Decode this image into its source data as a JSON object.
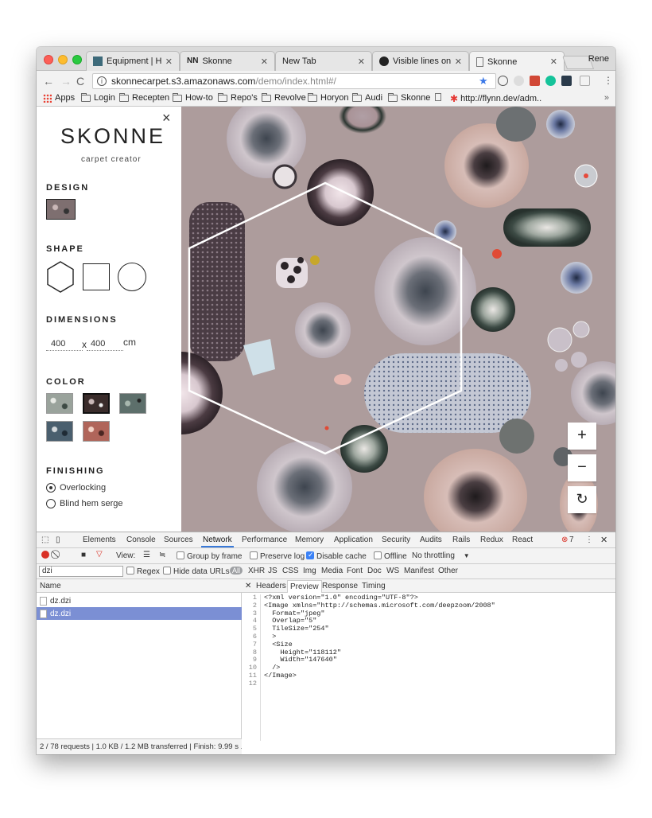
{
  "window": {
    "profile": "Rene",
    "tabs": [
      {
        "title": "Equipment | Horyo",
        "icon": "horyon-favicon"
      },
      {
        "title": "Skonne",
        "icon": "nn-favicon"
      },
      {
        "title": "New Tab",
        "icon": "blank"
      },
      {
        "title": "Visible lines on Fir",
        "icon": "github-favicon"
      },
      {
        "title": "Skonne",
        "icon": "page-icon"
      }
    ],
    "url_host": "skonnecarpet.s3.amazonaws.com",
    "url_path": "/demo/index.html#/",
    "bookmarks": [
      "Apps",
      "Login",
      "Recepten",
      "How-to",
      "Repo's",
      "Revolve",
      "Horyon",
      "Audi",
      "Skonne",
      "http://flynn.dev/adm.."
    ],
    "bookmarks_more": "»"
  },
  "sidebar": {
    "close": "×",
    "logo": "SKONNE",
    "subtitle": "carpet creator",
    "design_label": "DESIGN",
    "shape_label": "SHAPE",
    "dimensions_label": "DIMENSIONS",
    "width": "400",
    "height": "400",
    "times": "x",
    "unit": "cm",
    "color_label": "COLOR",
    "finishing_label": "FINISHING",
    "finishing_options": [
      "Overlocking",
      "Blind hem serge"
    ],
    "finishing_selected": "Overlocking",
    "color_swatches": [
      "#9aa39c",
      "#3a2c2b",
      "#5d6f6b",
      "#4a5f6e",
      "#b0655a"
    ]
  },
  "zoom": {
    "plus": "+",
    "minus": "−",
    "reset": "↻"
  },
  "devtools": {
    "tabs": [
      "Elements",
      "Console",
      "Sources",
      "Network",
      "Performance",
      "Memory",
      "Application",
      "Security",
      "Audits",
      "Rails",
      "Redux",
      "React"
    ],
    "active_tab": "Network",
    "error_count": "7",
    "toolbar": {
      "view": "View:",
      "group_by_frame": "Group by frame",
      "preserve_log": "Preserve log",
      "disable_cache": "Disable cache",
      "offline": "Offline",
      "throttling": "No throttling"
    },
    "filter_value": "dzi",
    "filter_opts": {
      "regex": "Regex",
      "hide_data_urls": "Hide data URLs",
      "all": "All"
    },
    "types": [
      "XHR",
      "JS",
      "CSS",
      "Img",
      "Media",
      "Font",
      "Doc",
      "WS",
      "Manifest",
      "Other"
    ],
    "name_header": "Name",
    "requests": [
      "dz.dzi",
      "dz.dzi"
    ],
    "status": "2 / 78 requests | 1.0 KB / 1.2 MB transferred | Finish: 9.99 s ...",
    "detail_tabs": [
      "Headers",
      "Preview",
      "Response",
      "Timing"
    ],
    "detail_active": "Preview",
    "code_lines": [
      "<?xml version=\"1.0\" encoding=\"UTF-8\"?>",
      "<Image xmlns=\"http://schemas.microsoft.com/deepzoom/2008\"",
      "  Format=\"jpeg\"",
      "  Overlap=\"5\"",
      "  TileSize=\"254\"",
      "  >",
      "  <Size",
      "    Height=\"118112\"",
      "    Width=\"147640\"",
      "  />",
      "</Image>",
      ""
    ]
  }
}
